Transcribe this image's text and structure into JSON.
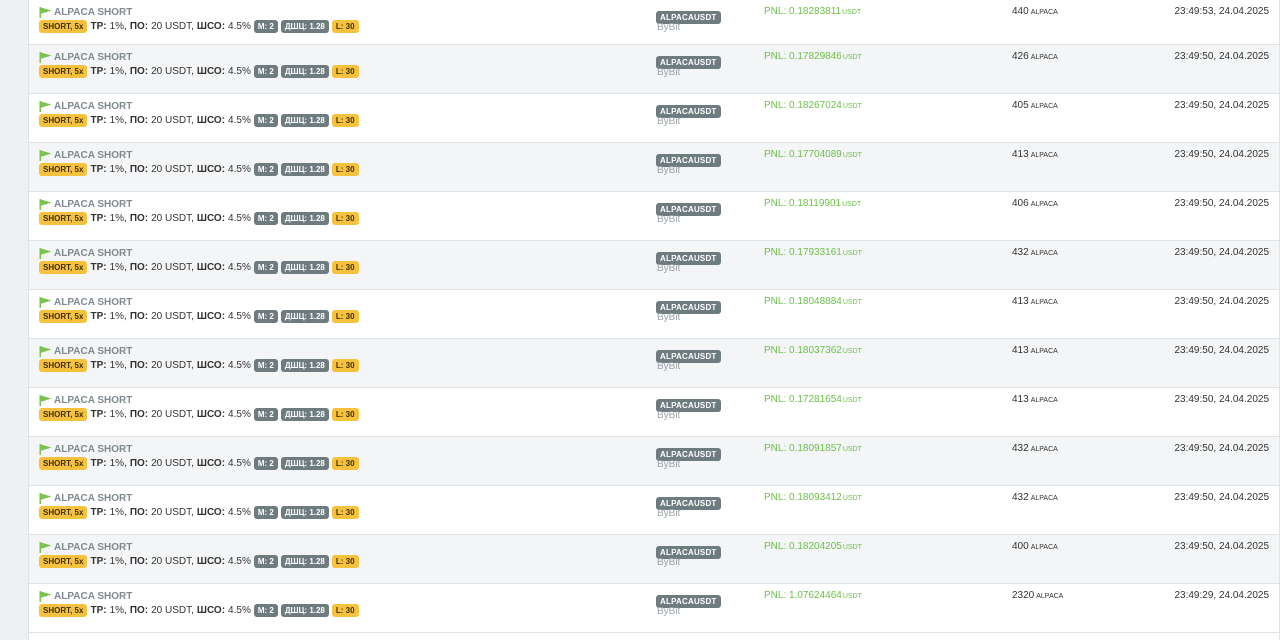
{
  "rows": [
    {
      "title": "ALPACA SHORT",
      "side_badge": "SHORT, 5x",
      "tp_label": "TP:",
      "tp_value": "1%,",
      "po_label": "ПО:",
      "po_value": "20 USDT,",
      "sho_label": "ШСО:",
      "sho_value": "4.5%",
      "m_badge": "M: 2",
      "dshch_badge": "ДШЦ: 1.28",
      "l_badge": "L: 30",
      "symbol": "ALPACAUSDT",
      "exchange": "ByBit",
      "pnl_label": "PNL:",
      "pnl_value": "0.18283811",
      "pnl_unit": "USDT",
      "qty_value": "440",
      "qty_unit": "ALPACA",
      "time": "23:49:53, 24.04.2025"
    },
    {
      "title": "ALPACA SHORT",
      "side_badge": "SHORT, 5x",
      "tp_label": "TP:",
      "tp_value": "1%,",
      "po_label": "ПО:",
      "po_value": "20 USDT,",
      "sho_label": "ШСО:",
      "sho_value": "4.5%",
      "m_badge": "M: 2",
      "dshch_badge": "ДШЦ: 1.28",
      "l_badge": "L: 30",
      "symbol": "ALPACAUSDT",
      "exchange": "ByBit",
      "pnl_label": "PNL:",
      "pnl_value": "0.17829846",
      "pnl_unit": "USDT",
      "qty_value": "426",
      "qty_unit": "ALPACA",
      "time": "23:49:50, 24.04.2025"
    },
    {
      "title": "ALPACA SHORT",
      "side_badge": "SHORT, 5x",
      "tp_label": "TP:",
      "tp_value": "1%,",
      "po_label": "ПО:",
      "po_value": "20 USDT,",
      "sho_label": "ШСО:",
      "sho_value": "4.5%",
      "m_badge": "M: 2",
      "dshch_badge": "ДШЦ: 1.28",
      "l_badge": "L: 30",
      "symbol": "ALPACAUSDT",
      "exchange": "ByBit",
      "pnl_label": "PNL:",
      "pnl_value": "0.18267024",
      "pnl_unit": "USDT",
      "qty_value": "405",
      "qty_unit": "ALPACA",
      "time": "23:49:50, 24.04.2025"
    },
    {
      "title": "ALPACA SHORT",
      "side_badge": "SHORT, 5x",
      "tp_label": "TP:",
      "tp_value": "1%,",
      "po_label": "ПО:",
      "po_value": "20 USDT,",
      "sho_label": "ШСО:",
      "sho_value": "4.5%",
      "m_badge": "M: 2",
      "dshch_badge": "ДШЦ: 1.28",
      "l_badge": "L: 30",
      "symbol": "ALPACAUSDT",
      "exchange": "ByBit",
      "pnl_label": "PNL:",
      "pnl_value": "0.17704089",
      "pnl_unit": "USDT",
      "qty_value": "413",
      "qty_unit": "ALPACA",
      "time": "23:49:50, 24.04.2025"
    },
    {
      "title": "ALPACA SHORT",
      "side_badge": "SHORT, 5x",
      "tp_label": "TP:",
      "tp_value": "1%,",
      "po_label": "ПО:",
      "po_value": "20 USDT,",
      "sho_label": "ШСО:",
      "sho_value": "4.5%",
      "m_badge": "M: 2",
      "dshch_badge": "ДШЦ: 1.28",
      "l_badge": "L: 30",
      "symbol": "ALPACAUSDT",
      "exchange": "ByBit",
      "pnl_label": "PNL:",
      "pnl_value": "0.18119901",
      "pnl_unit": "USDT",
      "qty_value": "406",
      "qty_unit": "ALPACA",
      "time": "23:49:50, 24.04.2025"
    },
    {
      "title": "ALPACA SHORT",
      "side_badge": "SHORT, 5x",
      "tp_label": "TP:",
      "tp_value": "1%,",
      "po_label": "ПО:",
      "po_value": "20 USDT,",
      "sho_label": "ШСО:",
      "sho_value": "4.5%",
      "m_badge": "M: 2",
      "dshch_badge": "ДШЦ: 1.28",
      "l_badge": "L: 30",
      "symbol": "ALPACAUSDT",
      "exchange": "ByBit",
      "pnl_label": "PNL:",
      "pnl_value": "0.17933161",
      "pnl_unit": "USDT",
      "qty_value": "432",
      "qty_unit": "ALPACA",
      "time": "23:49:50, 24.04.2025"
    },
    {
      "title": "ALPACA SHORT",
      "side_badge": "SHORT, 5x",
      "tp_label": "TP:",
      "tp_value": "1%,",
      "po_label": "ПО:",
      "po_value": "20 USDT,",
      "sho_label": "ШСО:",
      "sho_value": "4.5%",
      "m_badge": "M: 2",
      "dshch_badge": "ДШЦ: 1.28",
      "l_badge": "L: 30",
      "symbol": "ALPACAUSDT",
      "exchange": "ByBit",
      "pnl_label": "PNL:",
      "pnl_value": "0.18048884",
      "pnl_unit": "USDT",
      "qty_value": "413",
      "qty_unit": "ALPACA",
      "time": "23:49:50, 24.04.2025"
    },
    {
      "title": "ALPACA SHORT",
      "side_badge": "SHORT, 5x",
      "tp_label": "TP:",
      "tp_value": "1%,",
      "po_label": "ПО:",
      "po_value": "20 USDT,",
      "sho_label": "ШСО:",
      "sho_value": "4.5%",
      "m_badge": "M: 2",
      "dshch_badge": "ДШЦ: 1.28",
      "l_badge": "L: 30",
      "symbol": "ALPACAUSDT",
      "exchange": "ByBit",
      "pnl_label": "PNL:",
      "pnl_value": "0.18037362",
      "pnl_unit": "USDT",
      "qty_value": "413",
      "qty_unit": "ALPACA",
      "time": "23:49:50, 24.04.2025"
    },
    {
      "title": "ALPACA SHORT",
      "side_badge": "SHORT, 5x",
      "tp_label": "TP:",
      "tp_value": "1%,",
      "po_label": "ПО:",
      "po_value": "20 USDT,",
      "sho_label": "ШСО:",
      "sho_value": "4.5%",
      "m_badge": "M: 2",
      "dshch_badge": "ДШЦ: 1.28",
      "l_badge": "L: 30",
      "symbol": "ALPACAUSDT",
      "exchange": "ByBit",
      "pnl_label": "PNL:",
      "pnl_value": "0.17281654",
      "pnl_unit": "USDT",
      "qty_value": "413",
      "qty_unit": "ALPACA",
      "time": "23:49:50, 24.04.2025"
    },
    {
      "title": "ALPACA SHORT",
      "side_badge": "SHORT, 5x",
      "tp_label": "TP:",
      "tp_value": "1%,",
      "po_label": "ПО:",
      "po_value": "20 USDT,",
      "sho_label": "ШСО:",
      "sho_value": "4.5%",
      "m_badge": "M: 2",
      "dshch_badge": "ДШЦ: 1.28",
      "l_badge": "L: 30",
      "symbol": "ALPACAUSDT",
      "exchange": "ByBit",
      "pnl_label": "PNL:",
      "pnl_value": "0.18091857",
      "pnl_unit": "USDT",
      "qty_value": "432",
      "qty_unit": "ALPACA",
      "time": "23:49:50, 24.04.2025"
    },
    {
      "title": "ALPACA SHORT",
      "side_badge": "SHORT, 5x",
      "tp_label": "TP:",
      "tp_value": "1%,",
      "po_label": "ПО:",
      "po_value": "20 USDT,",
      "sho_label": "ШСО:",
      "sho_value": "4.5%",
      "m_badge": "M: 2",
      "dshch_badge": "ДШЦ: 1.28",
      "l_badge": "L: 30",
      "symbol": "ALPACAUSDT",
      "exchange": "ByBit",
      "pnl_label": "PNL:",
      "pnl_value": "0.18093412",
      "pnl_unit": "USDT",
      "qty_value": "432",
      "qty_unit": "ALPACA",
      "time": "23:49:50, 24.04.2025"
    },
    {
      "title": "ALPACA SHORT",
      "side_badge": "SHORT, 5x",
      "tp_label": "TP:",
      "tp_value": "1%,",
      "po_label": "ПО:",
      "po_value": "20 USDT,",
      "sho_label": "ШСО:",
      "sho_value": "4.5%",
      "m_badge": "M: 2",
      "dshch_badge": "ДШЦ: 1.28",
      "l_badge": "L: 30",
      "symbol": "ALPACAUSDT",
      "exchange": "ByBit",
      "pnl_label": "PNL:",
      "pnl_value": "0.18204205",
      "pnl_unit": "USDT",
      "qty_value": "400",
      "qty_unit": "ALPACA",
      "time": "23:49:50, 24.04.2025"
    },
    {
      "title": "ALPACA SHORT",
      "side_badge": "SHORT, 5x",
      "tp_label": "TP:",
      "tp_value": "1%,",
      "po_label": "ПО:",
      "po_value": "20 USDT,",
      "sho_label": "ШСО:",
      "sho_value": "4.5%",
      "m_badge": "M: 2",
      "dshch_badge": "ДШЦ: 1.28",
      "l_badge": "L: 30",
      "symbol": "ALPACAUSDT",
      "exchange": "ByBit",
      "pnl_label": "PNL:",
      "pnl_value": "1.07624464",
      "pnl_unit": "USDT",
      "qty_value": "2320",
      "qty_unit": "ALPACA",
      "time": "23:49:29, 24.04.2025"
    }
  ],
  "colors": {
    "flag_icon": "#7cc24e",
    "pnl_positive": "#6cc04a",
    "badge_yellow": "#f6c23e",
    "badge_grey": "#6e7b7f"
  }
}
